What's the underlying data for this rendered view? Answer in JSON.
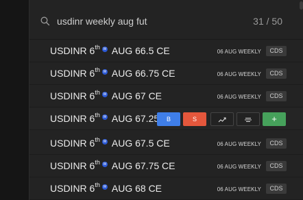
{
  "search": {
    "query": "usdinr weekly aug fut",
    "icon": "search-icon",
    "counter": "31 / 50"
  },
  "results": [
    {
      "root": "USDINR 6",
      "sup": "th",
      "rest": "AUG 66.5 CE",
      "expiry": "06 AUG WEEKLY",
      "exchange": "CDS",
      "weekly_marker": "W"
    },
    {
      "root": "USDINR 6",
      "sup": "th",
      "rest": "AUG 66.75 CE",
      "expiry": "06 AUG WEEKLY",
      "exchange": "CDS",
      "weekly_marker": "W"
    },
    {
      "root": "USDINR 6",
      "sup": "th",
      "rest": "AUG 67 CE",
      "expiry": "06 AUG WEEKLY",
      "exchange": "CDS",
      "weekly_marker": "W"
    },
    {
      "root": "USDINR 6",
      "sup": "th",
      "rest": "AUG 67.25 CE",
      "expiry": "",
      "exchange": "",
      "weekly_marker": "W"
    },
    {
      "root": "USDINR 6",
      "sup": "th",
      "rest": "AUG 67.5 CE",
      "expiry": "06 AUG WEEKLY",
      "exchange": "CDS",
      "weekly_marker": "W"
    },
    {
      "root": "USDINR 6",
      "sup": "th",
      "rest": "AUG 67.75 CE",
      "expiry": "06 AUG WEEKLY",
      "exchange": "CDS",
      "weekly_marker": "W"
    },
    {
      "root": "USDINR 6",
      "sup": "th",
      "rest": "AUG 68 CE",
      "expiry": "06 AUG WEEKLY",
      "exchange": "CDS",
      "weekly_marker": "W"
    }
  ],
  "hover_actions": {
    "buy": "B",
    "sell": "S",
    "add": "+",
    "chart_icon": "trend-chart-icon",
    "depth_icon": "market-depth-icon"
  },
  "colors": {
    "buy": "#3f7ee8",
    "sell": "#e4573c",
    "add": "#46a15b",
    "weekly_badge": "#2b59d6"
  }
}
